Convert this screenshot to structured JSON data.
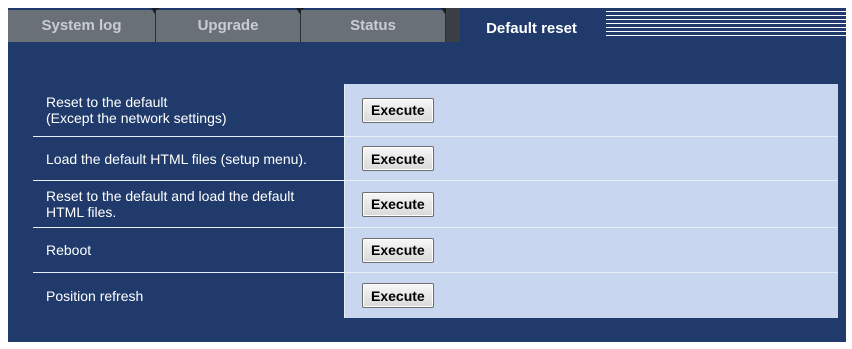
{
  "tabs": [
    {
      "label": "System log",
      "active": false
    },
    {
      "label": "Upgrade",
      "active": false
    },
    {
      "label": "Status",
      "active": false
    },
    {
      "label": "Default reset",
      "active": true
    }
  ],
  "rows": [
    {
      "label_line1": "Reset to the default",
      "label_line2": "(Except the network settings)",
      "button": "Execute"
    },
    {
      "label_line1": "Load the default HTML files (setup menu).",
      "label_line2": "",
      "button": "Execute"
    },
    {
      "label_line1": "Reset to the default and load the default",
      "label_line2": "HTML files.",
      "button": "Execute"
    },
    {
      "label_line1": "Reboot",
      "label_line2": "",
      "button": "Execute"
    },
    {
      "label_line1": "Position refresh",
      "label_line2": "",
      "button": "Execute"
    }
  ],
  "colors": {
    "panel": "#1f3a6b",
    "value_cell": "#c9d6ef",
    "tab_inactive": "#6a7077"
  }
}
